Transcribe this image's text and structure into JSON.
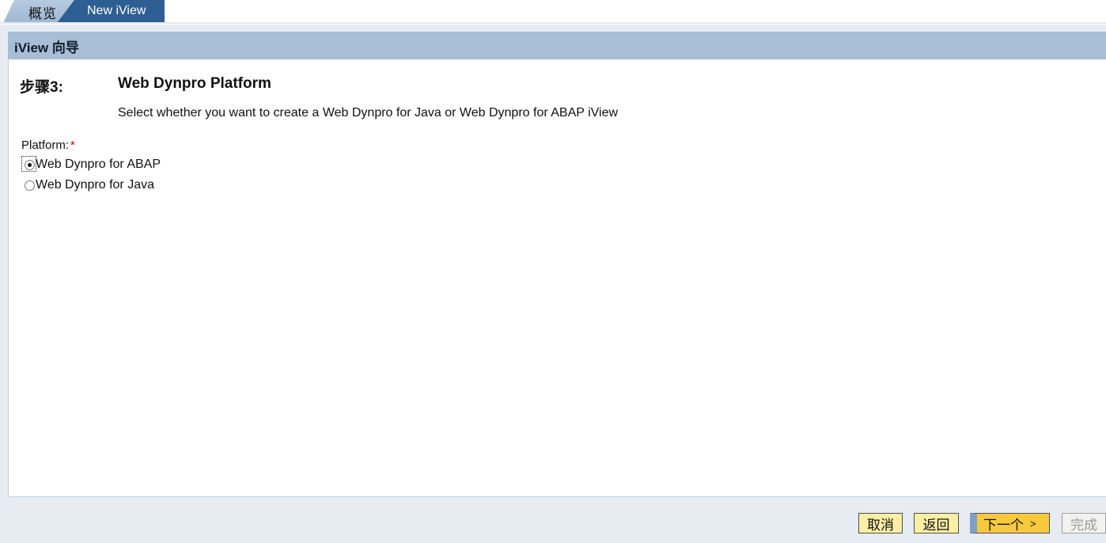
{
  "tabs": [
    {
      "label": "概览"
    },
    {
      "label": "New iView"
    }
  ],
  "panel": {
    "title": "iView 向导"
  },
  "step": {
    "label": "步骤3:",
    "title": "Web Dynpro Platform",
    "description": "Select whether you want to create a Web Dynpro for Java or Web Dynpro for ABAP iView"
  },
  "platform": {
    "label": "Platform:",
    "required_mark": "*",
    "options": [
      {
        "label": "Web Dynpro for ABAP",
        "selected": true
      },
      {
        "label": "Web Dynpro for Java",
        "selected": false
      }
    ]
  },
  "buttons": {
    "cancel": "取消",
    "back": "返回",
    "next": "下一个",
    "next_arrow": ">",
    "finish": "完成"
  },
  "colors": {
    "active_tab": "#2d5f92",
    "header_bar": "#a7bed6",
    "primary_button": "#f8c93d",
    "secondary_button": "#fbeea5",
    "required": "#cc0000"
  }
}
